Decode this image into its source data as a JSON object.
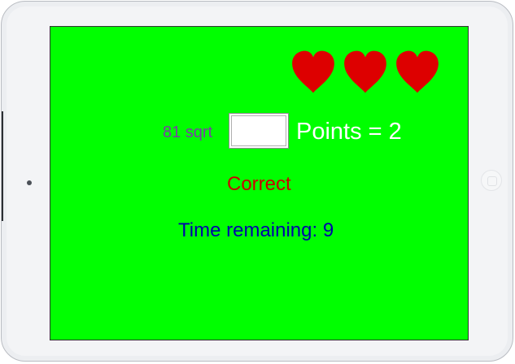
{
  "colors": {
    "screen_background": "#00ff00",
    "heart": "#dd0000",
    "question_text": "#7a3fa5",
    "points_text": "#ffffff",
    "feedback_text": "#cc0000",
    "timer_text": "#0000aa"
  },
  "lives": {
    "count": 3,
    "icon": "heart-icon"
  },
  "question": {
    "text": "81 sqrt"
  },
  "answer": {
    "value": ""
  },
  "score": {
    "text": "Points = 2"
  },
  "feedback": {
    "text": "Correct"
  },
  "timer": {
    "text": "Time remaining: 9"
  }
}
